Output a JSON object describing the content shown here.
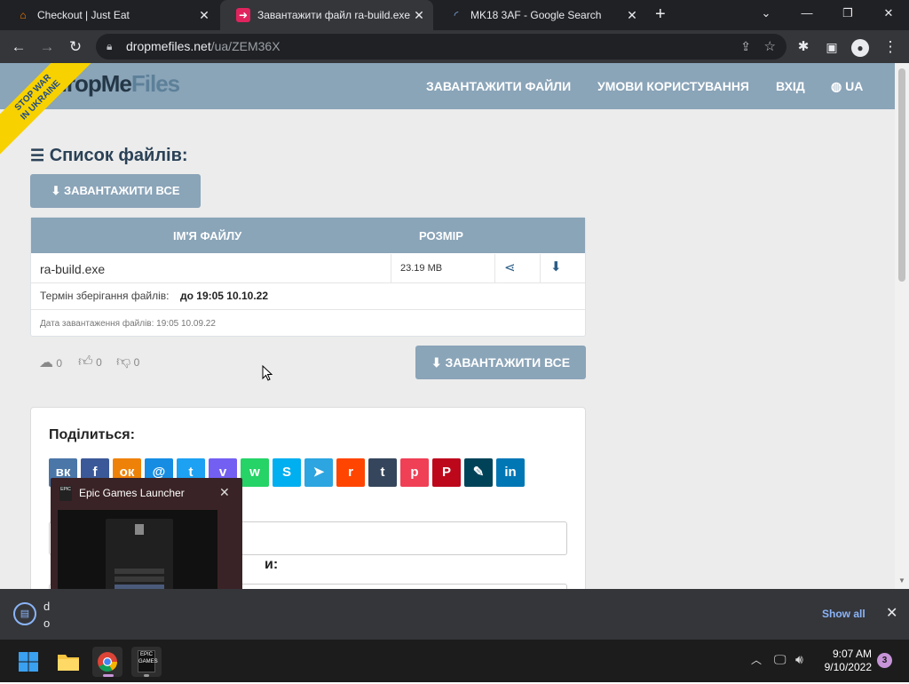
{
  "browser": {
    "tabs": [
      {
        "title": "Checkout | Just Eat",
        "icon": "home-icon",
        "color": "#ff8000"
      },
      {
        "title": "Завантажити файл ra-build.exe",
        "icon": "arrow-right-icon",
        "color": "#e0245e"
      },
      {
        "title": "MK18 3AF - Google Search",
        "icon": "loading-icon",
        "color": "#8ab4f8"
      }
    ],
    "new_tab": "+",
    "url_host": "dropmefiles.net",
    "url_path": "/ua/ZEM36X"
  },
  "site": {
    "logo_drop": "dropMe",
    "logo_files": "Files",
    "ribbon_line1": "STOP WAR",
    "ribbon_line2": "IN UKRAINE",
    "nav": [
      "ЗАВАНТАЖИТИ ФАЙЛИ",
      "УМОВИ КОРИСТУВАННЯ",
      "ВХІД",
      "UA"
    ]
  },
  "file_list": {
    "heading": "Список файлів:",
    "download_all": "ЗАВАНТАЖИТИ ВСЕ",
    "col_name": "ІМ'Я ФАЙЛУ",
    "col_size": "РОЗМІР",
    "files": [
      {
        "name": "ra-build.exe",
        "size": "23.19 MB"
      }
    ],
    "expiry_label": "Термін зберігання файлів:",
    "expiry_value": "до 19:05 10.10.22",
    "upload_label": "Дата завантаження файлів: 19:05 10.09.22"
  },
  "stats": {
    "downloads": "0",
    "likes": "0",
    "dislikes": "0"
  },
  "share": {
    "title": "Поділиться:",
    "networks": [
      {
        "name": "vk",
        "glyph": "вк",
        "color": "#4a76a8"
      },
      {
        "name": "facebook",
        "glyph": "f",
        "color": "#3b5998"
      },
      {
        "name": "odnoklassniki",
        "glyph": "ок",
        "color": "#ee8208"
      },
      {
        "name": "moimir",
        "glyph": "@",
        "color": "#168de2"
      },
      {
        "name": "twitter",
        "glyph": "t",
        "color": "#1da1f2"
      },
      {
        "name": "viber",
        "glyph": "v",
        "color": "#7360f2"
      },
      {
        "name": "whatsapp",
        "glyph": "w",
        "color": "#25d366"
      },
      {
        "name": "skype",
        "glyph": "S",
        "color": "#00aff0"
      },
      {
        "name": "telegram",
        "glyph": "➤",
        "color": "#2ca5e0"
      },
      {
        "name": "reddit",
        "glyph": "r",
        "color": "#ff4500"
      },
      {
        "name": "tumblr",
        "glyph": "t",
        "color": "#35465c"
      },
      {
        "name": "pocket",
        "glyph": "p",
        "color": "#ef4056"
      },
      {
        "name": "pinterest",
        "glyph": "P",
        "color": "#bd081c"
      },
      {
        "name": "livejournal",
        "glyph": "✎",
        "color": "#004359"
      },
      {
        "name": "linkedin",
        "glyph": "in",
        "color": "#0077b5"
      }
    ],
    "label_partial": "и:"
  },
  "popup": {
    "title": "Epic Games Launcher",
    "logo": "EPIC GAMES"
  },
  "downloads_bar": {
    "item_line1": "d",
    "item_line2": "o",
    "show_all": "Show all"
  },
  "taskbar": {
    "time": "9:07 AM",
    "date": "9/10/2022",
    "notif_count": "3",
    "epic_label": "EPIC GAMES"
  }
}
